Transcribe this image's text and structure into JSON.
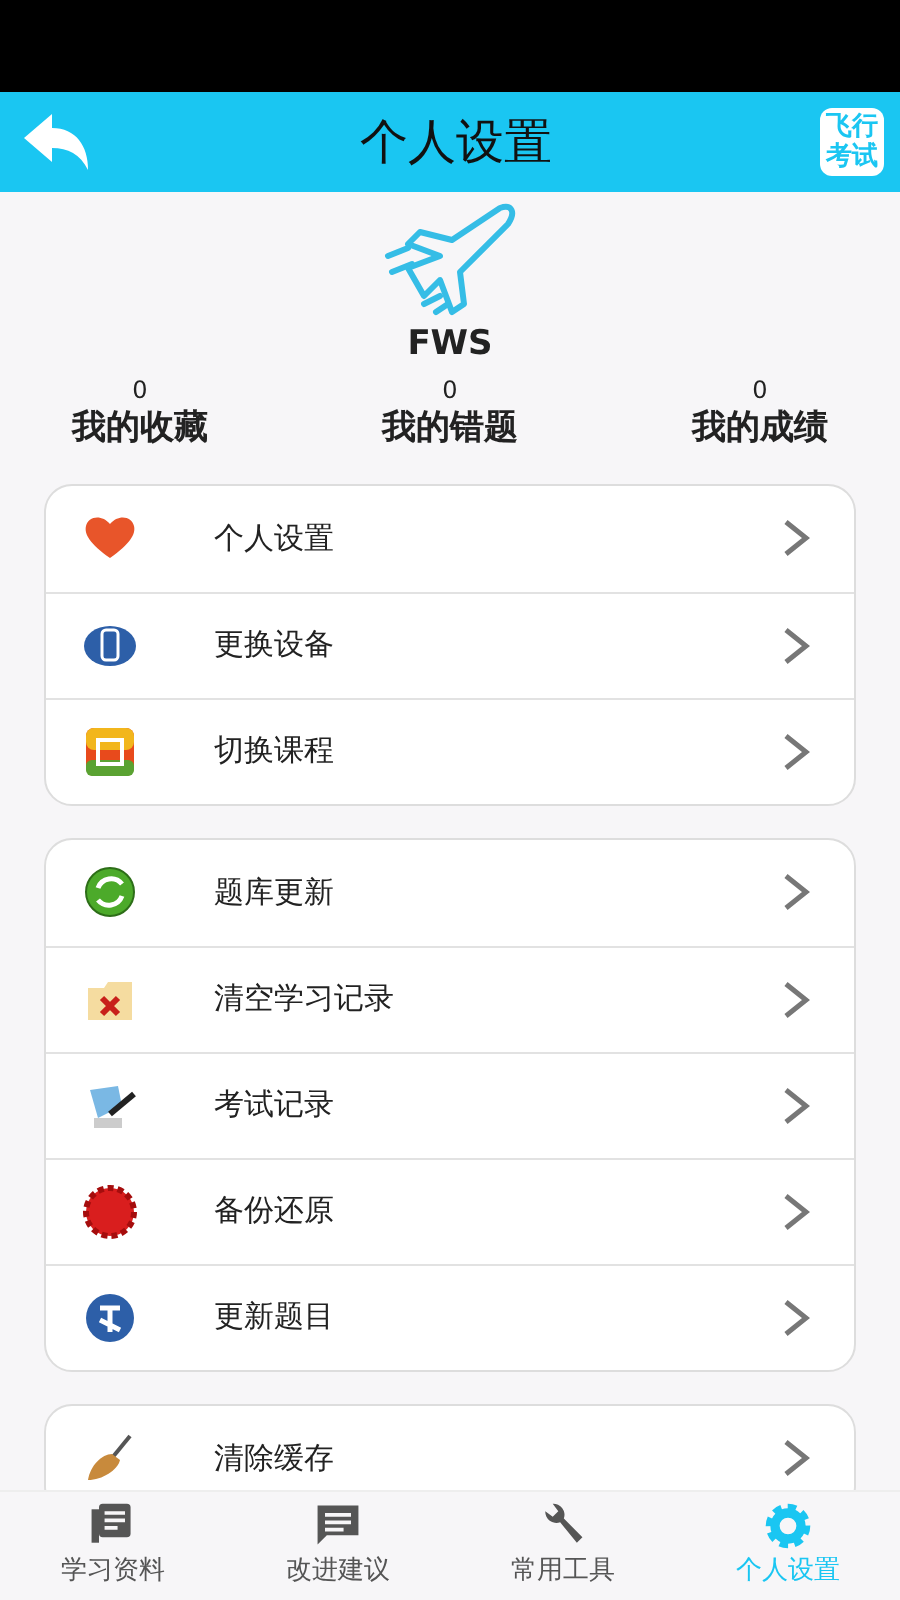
{
  "header": {
    "title": "个人设置",
    "logo_lines": [
      "飞行",
      "考试"
    ]
  },
  "profile": {
    "name": "FWS",
    "stats": [
      {
        "count": "0",
        "label": "我的收藏"
      },
      {
        "count": "0",
        "label": "我的错题"
      },
      {
        "count": "0",
        "label": "我的成绩"
      }
    ]
  },
  "groups": [
    {
      "items": [
        {
          "label": "个人设置"
        },
        {
          "label": "更换设备"
        },
        {
          "label": "切换课程"
        }
      ]
    },
    {
      "items": [
        {
          "label": "题库更新"
        },
        {
          "label": "清空学习记录"
        },
        {
          "label": "考试记录"
        },
        {
          "label": "备份还原"
        },
        {
          "label": "更新题目"
        }
      ]
    },
    {
      "items": [
        {
          "label": "清除缓存"
        }
      ]
    }
  ],
  "tabs": [
    {
      "label": "学习资料",
      "selected": false
    },
    {
      "label": "改进建议",
      "selected": false
    },
    {
      "label": "常用工具",
      "selected": false
    },
    {
      "label": "个人设置",
      "selected": true
    }
  ]
}
